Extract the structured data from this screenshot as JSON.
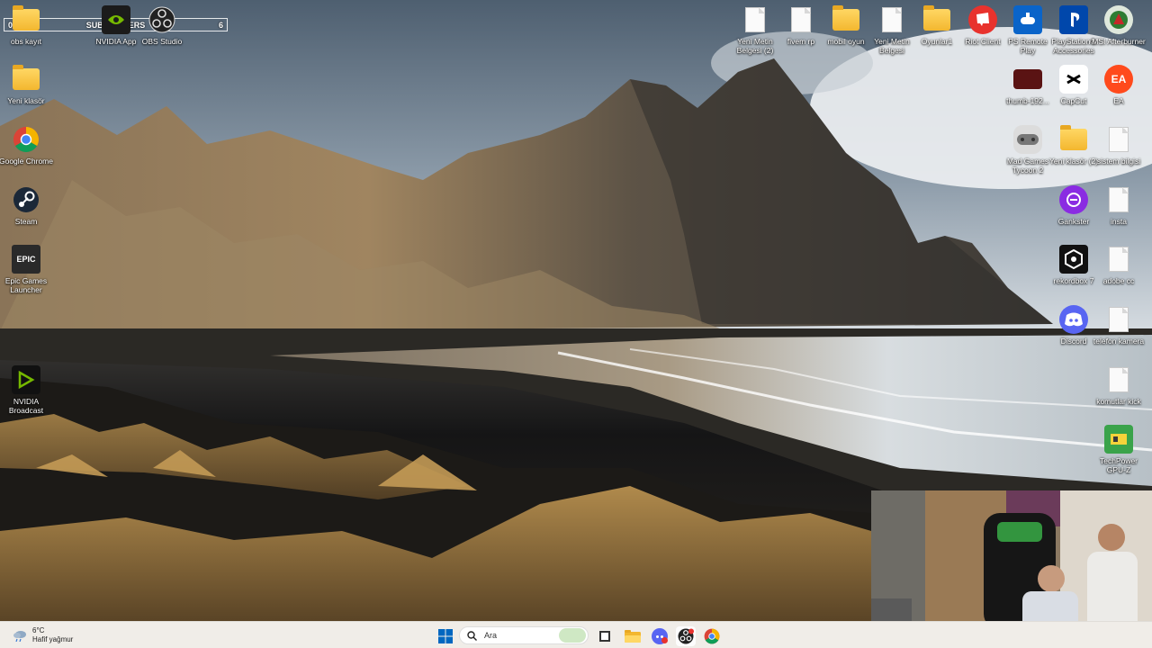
{
  "overlay": {
    "subscribers_label": "SUBSCRIBERS",
    "left_count": "0",
    "right_count": "6"
  },
  "desktop_left": [
    {
      "label": "obs kayıt",
      "icon": "folder-icon"
    },
    {
      "label": "NVIDIA App",
      "icon": "nvidia-app-icon"
    },
    {
      "label": "OBS Studio",
      "icon": "obs-studio-icon"
    },
    {
      "label": "Yeni klasör",
      "icon": "folder-icon"
    },
    {
      "label": "Google Chrome",
      "icon": "chrome-icon"
    },
    {
      "label": "Steam",
      "icon": "steam-icon"
    },
    {
      "label": "Epic Games Launcher",
      "icon": "epic-games-icon"
    },
    {
      "label": "NVIDIA Broadcast",
      "icon": "nvidia-broadcast-icon"
    }
  ],
  "desktop_right_top": [
    {
      "label": "Yeni Metin Belgesi (2)",
      "icon": "text-document-icon"
    },
    {
      "label": "fivem rp",
      "icon": "text-document-icon"
    },
    {
      "label": "mobil oyun",
      "icon": "folder-icon"
    },
    {
      "label": "Yeni Metin Belgesi",
      "icon": "text-document-icon"
    },
    {
      "label": "Oyunlar1",
      "icon": "folder-icon"
    },
    {
      "label": "Riot Client",
      "icon": "riot-client-icon"
    },
    {
      "label": "PS Remote Play",
      "icon": "ps-remote-play-icon"
    },
    {
      "label": "PlayStation® Accessories",
      "icon": "playstation-accessories-icon"
    },
    {
      "label": "MSI Afterburner",
      "icon": "msi-afterburner-icon"
    }
  ],
  "desktop_right_column": [
    {
      "label": "thumb-192...",
      "icon": "image-thumbnail-icon"
    },
    {
      "label": "CapCut",
      "icon": "capcut-icon"
    },
    {
      "label": "EA",
      "icon": "ea-icon"
    },
    {
      "label": "Mad Games Tycoon 2",
      "icon": "gamepad-icon"
    },
    {
      "label": "Yeni klasör (2)",
      "icon": "folder-icon"
    },
    {
      "label": "sistem bilgisi",
      "icon": "text-document-icon"
    },
    {
      "label": "Gankster",
      "icon": "gankster-icon"
    },
    {
      "label": "insta",
      "icon": "text-document-icon"
    },
    {
      "label": "rekordbox 7",
      "icon": "rekordbox-icon"
    },
    {
      "label": "adobe cc",
      "icon": "text-document-icon"
    },
    {
      "label": "Discord",
      "icon": "discord-icon"
    },
    {
      "label": "telefon kamera",
      "icon": "text-document-icon"
    },
    {
      "label": "komutlar kick",
      "icon": "text-document-icon"
    },
    {
      "label": "TechPower GPU-Z",
      "icon": "gpu-z-icon"
    }
  ],
  "taskbar": {
    "weather_temp": "6°C",
    "weather_desc": "Hafif yağmur",
    "search_placeholder": "Ara",
    "apps": [
      "start-icon",
      "search-icon",
      "widgets-icon",
      "task-view-icon",
      "file-explorer-icon",
      "discord-icon",
      "obs-studio-icon",
      "chrome-icon"
    ]
  },
  "colors": {
    "taskbar_bg": "#f0ede8",
    "folder_yellow": "#f3b72f",
    "accent_blue": "#0067c0"
  }
}
